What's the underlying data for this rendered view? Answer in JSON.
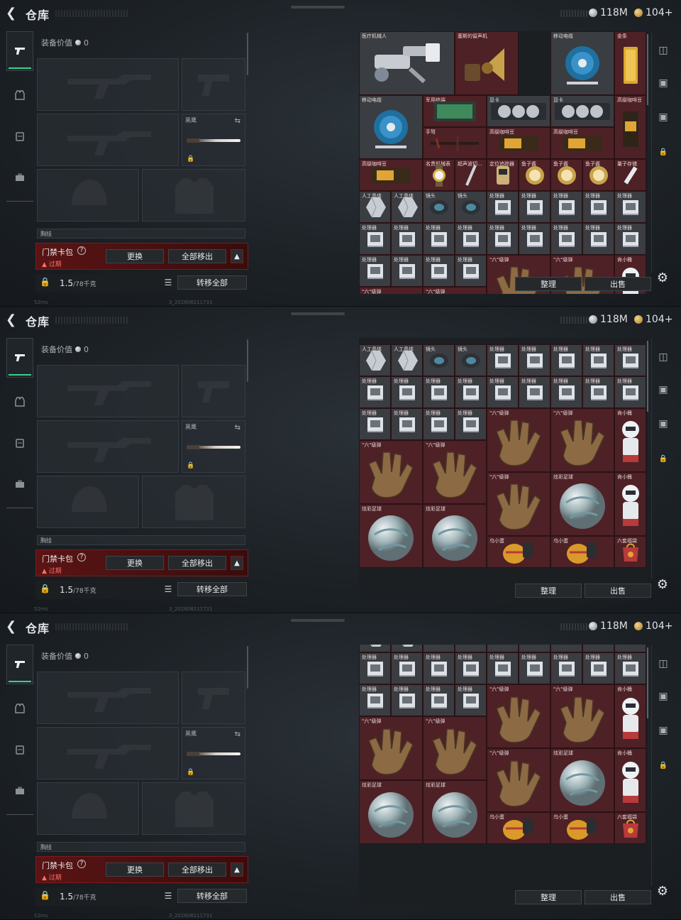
{
  "app": {
    "title": "仓库",
    "currency_silver": "118M",
    "currency_gold": "104+"
  },
  "equipment": {
    "value_label": "装备价值",
    "value": "0",
    "melee_label": "黑鹰",
    "pouch_label": "胸挂"
  },
  "keycard": {
    "label": "门禁卡包",
    "help": "?",
    "status": "过期",
    "replace_btn": "更换",
    "remove_all_btn": "全部移出"
  },
  "storage": {
    "weight": "1.5",
    "weight_unit": "/78千克",
    "transfer_all_btn": "转移全部"
  },
  "status": {
    "ping": "52ms",
    "build": "3_202608211731"
  },
  "stash": {
    "sort_btn": "整理",
    "sell_btn": "出售",
    "labels": {
      "medical_arm": "医疗机械人",
      "gramophone": "塞斯的留声机",
      "cable_reel": "移动电缆",
      "gold_bar": "金条",
      "tablet": "军用终端",
      "gpu": "显卡",
      "coffee": "高级咖啡豆",
      "crossbow": "手弩",
      "watch": "名贵机械表",
      "probe": "超声波切...",
      "positioner": "定位追踪器",
      "capsule": "鱼子酱",
      "usb": "量子存储",
      "crystal": "人工晶体",
      "lens": "镜头",
      "processor": "处理器",
      "hand": "\"六\"级弹",
      "ball": "炫彩足球",
      "figurine": "肯小桶",
      "egg": "乌小蛋",
      "gift": "六套福袋"
    }
  },
  "colors": {
    "accent_green": "#3bd08a",
    "cell_red": "#4e2126",
    "keycard_red": "#5a1414",
    "expired_red": "#ff6b6b"
  }
}
